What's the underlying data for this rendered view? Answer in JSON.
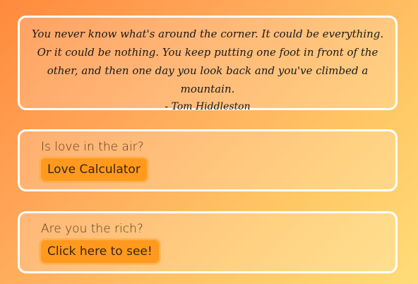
{
  "quote": {
    "text": "You never know what's around the corner. It could be everything. Or it could be nothing. You keep putting one foot in front of the other, and then one day you look back and you've climbed a mountain.",
    "author": "- Tom Hiddleston"
  },
  "cards": [
    {
      "question": "Is love in the air?",
      "button_label": "Love Calculator"
    },
    {
      "question": "Are you the rich?",
      "button_label": "Click here to see!"
    }
  ],
  "colors": {
    "gradient_start": "#ff8a3d",
    "gradient_end": "#ffdc78",
    "button_bg": "#ff9a1f",
    "card_border": "#ffffff"
  }
}
